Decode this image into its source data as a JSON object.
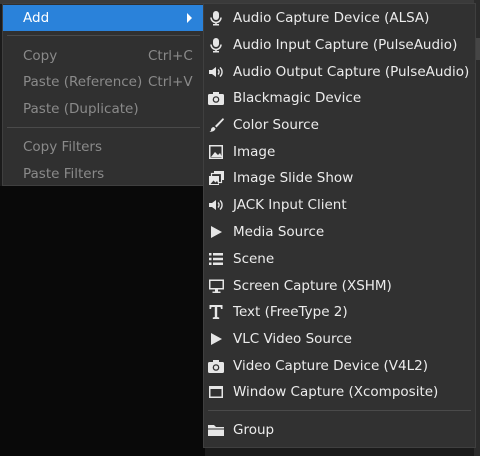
{
  "context_menu": {
    "items": [
      {
        "label": "Add",
        "shortcut": "",
        "state": "active",
        "has_submenu": true
      },
      {
        "label": "Copy",
        "shortcut": "Ctrl+C",
        "state": "disabled"
      },
      {
        "label": "Paste (Reference)",
        "shortcut": "Ctrl+V",
        "state": "disabled"
      },
      {
        "label": "Paste (Duplicate)",
        "shortcut": "",
        "state": "disabled"
      },
      {
        "label": "Copy Filters",
        "shortcut": "",
        "state": "disabled"
      },
      {
        "label": "Paste Filters",
        "shortcut": "",
        "state": "disabled"
      }
    ]
  },
  "add_submenu": {
    "items": [
      {
        "label": "Audio Capture Device (ALSA)",
        "icon": "microphone-icon"
      },
      {
        "label": "Audio Input Capture (PulseAudio)",
        "icon": "microphone-icon"
      },
      {
        "label": "Audio Output Capture (PulseAudio)",
        "icon": "speaker-icon"
      },
      {
        "label": "Blackmagic Device",
        "icon": "camera-icon"
      },
      {
        "label": "Color Source",
        "icon": "paintbrush-icon"
      },
      {
        "label": "Image",
        "icon": "image-icon"
      },
      {
        "label": "Image Slide Show",
        "icon": "slideshow-icon"
      },
      {
        "label": "JACK Input Client",
        "icon": "speaker-icon"
      },
      {
        "label": "Media Source",
        "icon": "play-icon"
      },
      {
        "label": "Scene",
        "icon": "list-icon"
      },
      {
        "label": "Screen Capture (XSHM)",
        "icon": "monitor-icon"
      },
      {
        "label": "Text (FreeType 2)",
        "icon": "text-icon"
      },
      {
        "label": "VLC Video Source",
        "icon": "play-icon"
      },
      {
        "label": "Video Capture Device (V4L2)",
        "icon": "camera-icon"
      },
      {
        "label": "Window Capture (Xcomposite)",
        "icon": "window-icon"
      },
      {
        "label": "Group",
        "icon": "folder-icon"
      }
    ]
  },
  "colors": {
    "highlight": "#2a82da",
    "menu_bg": "#303030",
    "disabled_text": "#8a8a8a"
  }
}
